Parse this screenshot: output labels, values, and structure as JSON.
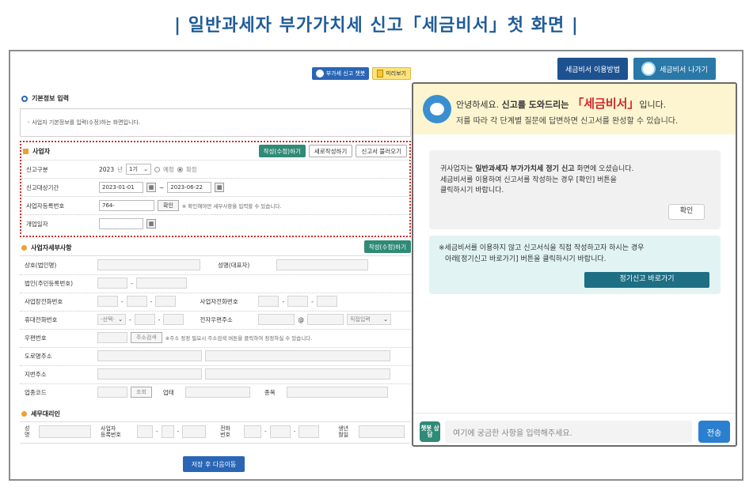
{
  "page_title": "| 일반과세자 부가가치세 신고「세금비서」첫 화면 |",
  "left": {
    "chatbot_button": "부가세 신고 챗봇",
    "preview_button": "미리보기",
    "basic_section_title": "기본정보 입력",
    "basic_info_text": "◦ 사업자 기본정보를 입력(수정)하는 화면입니다.",
    "business_section": {
      "title": "사업자",
      "btn_edit": "작성(수정)하기",
      "btn_new": "새로작성하기",
      "btn_load": "신고서 불러오기",
      "rows": {
        "filing_type": {
          "label": "신고구분",
          "year": "2023",
          "year_unit": "년",
          "period": "1기",
          "opt_scheduled": "예정",
          "opt_final": "확정"
        },
        "period": {
          "label": "신고대상기간",
          "from": "2023-01-01",
          "to": "2023-06-22",
          "tilde": "~"
        },
        "biz_no": {
          "label": "사업자등록번호",
          "value": "764-",
          "confirm": "확인",
          "hint": "※ 확인해야만 세부사항을 입력할 수 있습니다."
        },
        "open_date": {
          "label": "개업일자"
        }
      }
    },
    "detail_section": {
      "title": "사업자세부사항",
      "btn_edit": "작성(수정)하기",
      "labels": {
        "trade_name": "상호(법인명)",
        "rep_name": "성명(대표자)",
        "corp_no": "법인(주민등록번호)",
        "office_phone": "사업장전화번호",
        "biz_phone": "사업자전화번호",
        "mobile": "휴대전화번호",
        "mobile_select": "-선택-",
        "email": "전자우편주소",
        "email_at": "@",
        "email_select": "직접입력",
        "postcode": "우편번호",
        "address_search": "주소검색",
        "address_hint": "※주소 정정 필요시 주소검색 버튼을 클릭하여 정정하실 수 있습니다.",
        "road_addr": "도로명주소",
        "lot_addr": "지번주소",
        "industry_code": "업종코드",
        "lookup": "조회",
        "business_type": "업태",
        "item": "종목",
        "dash": "-"
      }
    },
    "agent_section": {
      "title": "세무대리인",
      "name_label_1": "성",
      "name_label_2": "명",
      "bizno_label_1": "사업자",
      "bizno_label_2": "등록번호",
      "phone_label_1": "전화",
      "phone_label_2": "번호",
      "birth_label_1": "생년",
      "birth_label_2": "월일"
    },
    "save_button": "저장 후 다음이동"
  },
  "right": {
    "btn_guide": "세금비서 이용방법",
    "btn_exit": "세금비서 나가기",
    "greeting_pre": "안녕하세요. ",
    "greeting_bold": "신고를 도와드리는 ",
    "greeting_brand": "「세금비서」",
    "greeting_post": "입니다.",
    "greeting_line2": "저를 따라 각 단계별 질문에 답변하면 신고서를 완성할 수 있습니다.",
    "msg1_pre": "귀사업자는 ",
    "msg1_bold": "일반과세자 부가가치세 정기 신고",
    "msg1_post": " 화면에 오셨습니다.",
    "msg1_line2": "세금비서를 이용하여 신고서를 작성하는 경우 [확인] 버튼을",
    "msg1_line3": "클릭하시기 바랍니다.",
    "ok_button": "확인",
    "msg2_line1": "※세금비서를 이용하지 않고 신고서식을 직접 작성하고자 하시는 경우",
    "msg2_line2": "아래[정기신고 바로가기] 버튼을 클릭하시기 바랍니다.",
    "go_button": "정기신고 바로가기",
    "chat_badge": "챗봇 상담",
    "input_placeholder": "여기에 궁금한 사항을 입력해주세요.",
    "send_button": "전송"
  }
}
